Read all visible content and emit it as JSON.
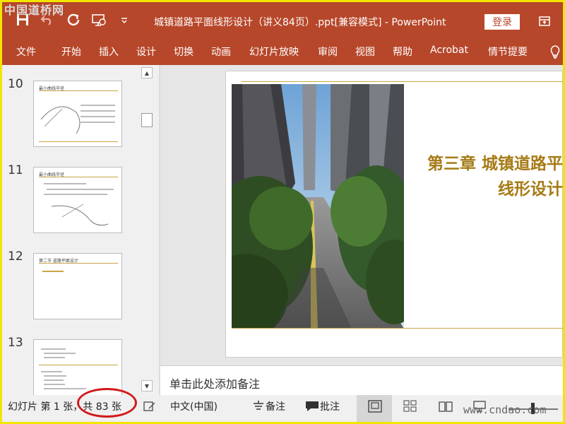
{
  "window": {
    "title": "城镇道路平面线形设计（讲义84页）.ppt[兼容模式]  -  PowerPoint",
    "login_label": "登录",
    "accent_color": "#b7472a"
  },
  "menu": {
    "tabs": [
      "文件",
      "开始",
      "插入",
      "设计",
      "切换",
      "动画",
      "幻灯片放映",
      "审阅",
      "视图",
      "帮助",
      "Acrobat",
      "情节提要"
    ]
  },
  "thumbnails": [
    {
      "number": "10",
      "header": "最小曲线半径"
    },
    {
      "number": "11",
      "header": "最小曲线半径"
    },
    {
      "number": "12",
      "header": "第二节 道路平面设计"
    },
    {
      "number": "13",
      "header": ""
    }
  ],
  "slide": {
    "title_line1": "第三章 城镇道路平",
    "title_line2": "线形设计"
  },
  "notes": {
    "placeholder": "单击此处添加备注"
  },
  "status": {
    "slide_info": "幻灯片 第 1 张，共 83 张",
    "language": "中文(中国)",
    "notes_label": "备注",
    "comments_label": "批注"
  },
  "watermarks": {
    "top_left": "中国道桥网",
    "bottom_right": "www.cndao.com"
  }
}
